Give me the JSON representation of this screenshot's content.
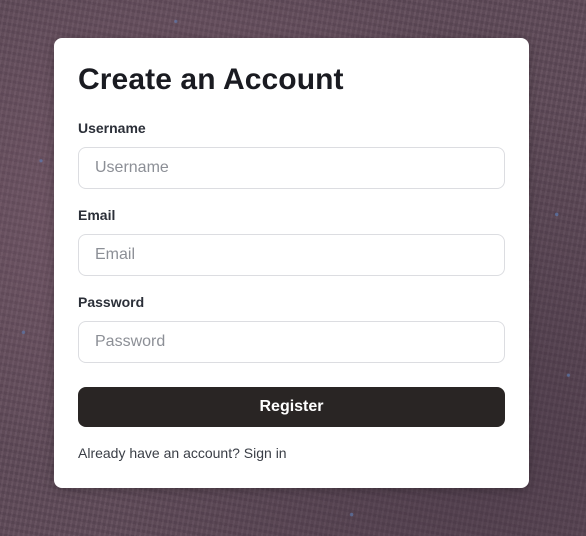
{
  "form": {
    "title": "Create an Account",
    "fields": [
      {
        "label": "Username",
        "placeholder": "Username",
        "value": ""
      },
      {
        "label": "Email",
        "placeholder": "Email",
        "value": ""
      },
      {
        "label": "Password",
        "placeholder": "Password",
        "value": ""
      }
    ],
    "submit_label": "Register",
    "signin_prompt": "Already have an account?",
    "signin_link": "Sign in"
  },
  "colors": {
    "card_background": "#ffffff",
    "button_background": "#292524",
    "button_text": "#ffffff",
    "title_text": "#1a1b21",
    "input_border": "#dcdde1",
    "placeholder_text": "#8c8f96"
  }
}
